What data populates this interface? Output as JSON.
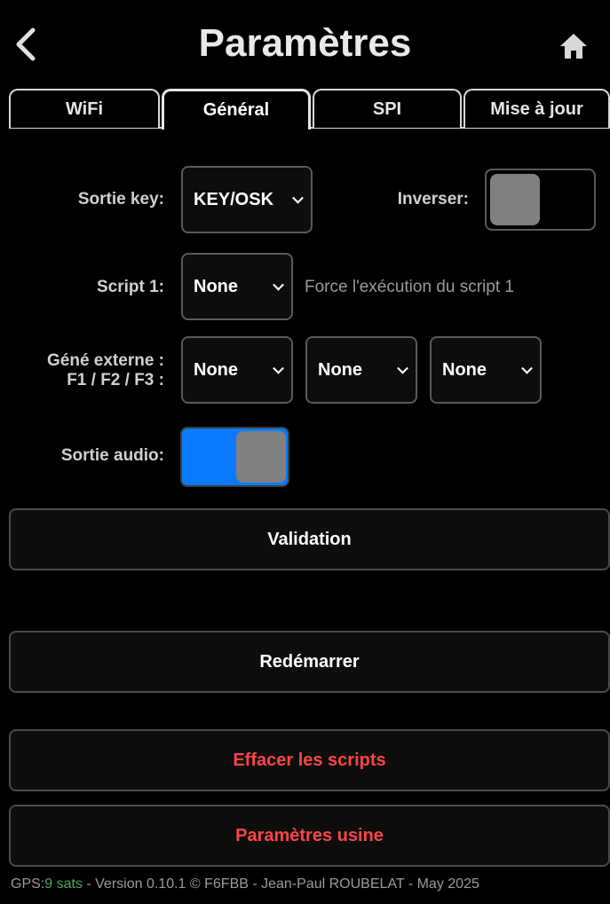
{
  "header": {
    "title": "Paramètres",
    "back_icon": "chevron-left-icon",
    "home_icon": "home-icon"
  },
  "tabs": [
    {
      "label": "WiFi",
      "active": false
    },
    {
      "label": "Général",
      "active": true
    },
    {
      "label": "SPI",
      "active": false
    },
    {
      "label": "Mise à jour",
      "active": false
    }
  ],
  "form": {
    "sortie_key": {
      "label": "Sortie key:",
      "value": "KEY/OSK"
    },
    "inverser": {
      "label": "Inverser:",
      "checked": false
    },
    "script1": {
      "label": "Script 1:",
      "value": "None",
      "note": "Force l'exécution du script 1"
    },
    "gene_externe": {
      "label_line1": "Géné externe :",
      "label_line2": "F1 / F2 / F3 :",
      "f1": "None",
      "f2": "None",
      "f3": "None"
    },
    "sortie_audio": {
      "label": "Sortie audio:",
      "checked": true
    }
  },
  "buttons": {
    "validation": "Validation",
    "redemarrer": "Redémarrer",
    "effacer_scripts": "Effacer les scripts",
    "parametres_usine": "Paramètres usine"
  },
  "footer": {
    "gps_label": "GPS:",
    "gps_value": "9 sats",
    "text": " - Version 0.10.1 © F6FBB - Jean-Paul ROUBELAT - May 2025"
  },
  "colors": {
    "accent": "#0a7bff",
    "danger": "#ff4545",
    "gps": "#4caf50"
  }
}
